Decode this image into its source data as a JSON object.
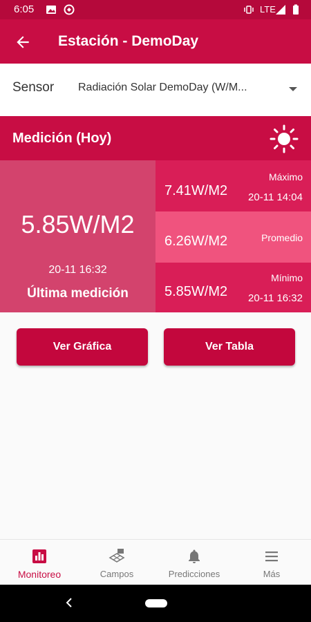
{
  "status_bar": {
    "time": "6:05",
    "network": "LTE"
  },
  "app_bar": {
    "title": "Estación - DemoDay"
  },
  "sensor": {
    "label": "Sensor",
    "selected": "Radiación Solar DemoDay (W/M..."
  },
  "measurement": {
    "title": "Medición (Hoy)",
    "last": {
      "value": "5.85W/M2",
      "timestamp": "20-11 16:32",
      "label": "Última medición"
    },
    "max": {
      "value": "7.41W/M2",
      "label": "Máximo",
      "timestamp": "20-11 14:04"
    },
    "avg": {
      "value": "6.26W/M2",
      "label": "Promedio"
    },
    "min": {
      "value": "5.85W/M2",
      "label": "Mínimo",
      "timestamp": "20-11 16:32"
    }
  },
  "actions": {
    "chart": "Ver Gráfica",
    "table": "Ver Tabla"
  },
  "bottom_nav": [
    {
      "label": "Monitoreo",
      "icon": "bar-chart-icon",
      "active": true
    },
    {
      "label": "Campos",
      "icon": "fields-icon",
      "active": false
    },
    {
      "label": "Predicciones",
      "icon": "bell-icon",
      "active": false
    },
    {
      "label": "Más",
      "icon": "menu-icon",
      "active": false
    }
  ],
  "colors": {
    "primary": "#c80d44",
    "status_bar": "#b5093b",
    "last_panel": "#d3436d",
    "cell_dark": "#d91e57",
    "cell_light": "#f0537e"
  }
}
